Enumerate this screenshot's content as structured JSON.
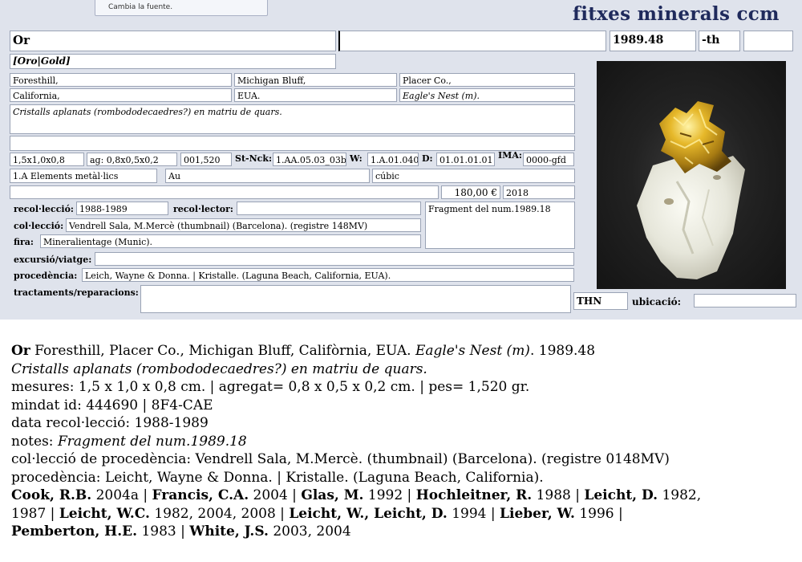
{
  "popup": {
    "label": "Cambia la fuente."
  },
  "app_title": "fitxes minerals ccm",
  "record": {
    "mineral": "Or",
    "field_top_middle": "",
    "number": "1989.48",
    "suffix": "-th",
    "field_top_right": "",
    "synonyms": "[Oro|Gold]",
    "loc1_a": "Foresthill,",
    "loc1_b": "Michigan Bluff,",
    "loc1_c": "Placer Co.,",
    "loc2_a": "California,",
    "loc2_b": "EUA.",
    "loc2_c": "Eagle's Nest (m).",
    "description": "Cristalls aplanats (rombododecaedres?) en matriu de quars.",
    "dims": "1,5x1,0x0,8",
    "aggregate": "ag: 0,8x0,5x0,2",
    "weight": "001,520",
    "stnck_label": "St-Nck:",
    "stnck": "1.AA.05.03_03b",
    "w_label": "W:",
    "w": "1.A.01.040",
    "d_label": "D:",
    "d": "01.01.01.01",
    "ima_label": "IMA:",
    "ima": "0000-gfd",
    "class": "1.A Elements metàl·lics",
    "formula": "Au",
    "system": "cúbic",
    "price": "180,00 €",
    "year": "2018",
    "recollection_label": "recol·lecció:",
    "recollection": "1988-1989",
    "collector_label": "recol·lector:",
    "collector": "",
    "notes": "Fragment del num.1989.18",
    "collection_label": "col·lecció:",
    "collection": "Vendrell Sala, M.Mercè (thumbnail) (Barcelona). (registre 148MV)",
    "fair_label": "fira:",
    "fair": "Mineralientage (Munic).",
    "trip_label": "excursió/viatge:",
    "trip": "",
    "provenance_label": "procedència:",
    "provenance": "Leich, Wayne & Donna. | Kristalle. (Laguna Beach, California, EUA).",
    "treatments_label": "tractaments/reparacions:",
    "treatments": "",
    "thn": "THN",
    "location_label": "ubicació:",
    "location": ""
  },
  "summary": {
    "l1_name": "Or",
    "l1_locality": "Foresthill, Placer Co., Michigan Bluff, Califòrnia, EUA.",
    "l1_mine": "Eagle's Nest (m)",
    "l1_dot": ".",
    "l1_number": "1989.48",
    "l2": "Cristalls aplanats (rombododecaedres?) en matriu de quars.",
    "l3": "mesures: 1,5 x 1,0 x 0,8 cm. | agregat= 0,8 x 0,5 x 0,2 cm. | pes= 1,520 gr.",
    "l4": "mindat id: 444690 | 8F4-CAE",
    "l5": "data recol·lecció: 1988-1989",
    "l6_label": "notes:",
    "l6_value": "Fragment del num.1989.18",
    "l7": "col·lecció de procedència: Vendrell Sala, M.Mercè. (thumbnail) (Barcelona). (registre 0148MV)",
    "l8": "procedència: Leicht, Wayne & Donna. | Kristalle. (Laguna Beach, California).",
    "refs": [
      {
        "author": "Cook, R.B.",
        "years": "2004a"
      },
      {
        "author": "Francis, C.A.",
        "years": "2004"
      },
      {
        "author": "Glas, M.",
        "years": "1992"
      },
      {
        "author": "Hochleitner, R.",
        "years": "1988"
      },
      {
        "author": "Leicht, D.",
        "years": "1982,"
      },
      {
        "author": "",
        "years": "1987"
      },
      {
        "author": "Leicht, W.C.",
        "years": "1982, 2004, 2008"
      },
      {
        "author": "Leicht, W., Leicht, D.",
        "years": "1994"
      },
      {
        "author": "Lieber, W.",
        "years": "1996"
      },
      {
        "author": "Pemberton, H.E.",
        "years": "1983"
      },
      {
        "author": "White, J.S.",
        "years": "2003, 2004"
      }
    ],
    "sep": "|"
  }
}
